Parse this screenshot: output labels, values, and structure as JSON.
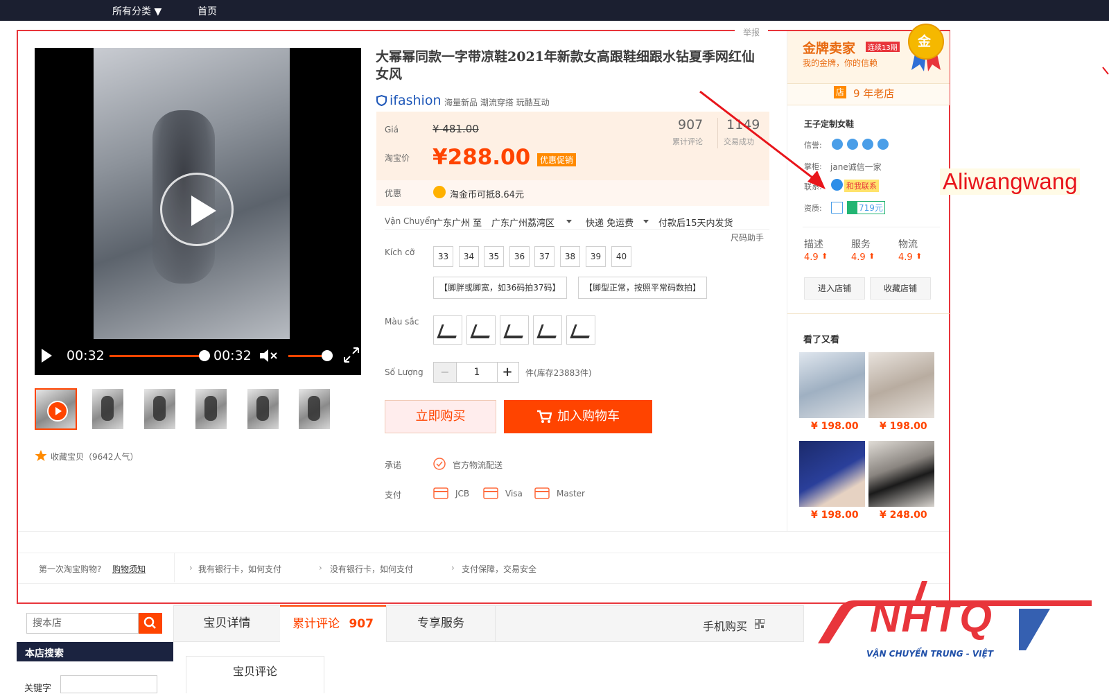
{
  "topnav": {
    "all_categories": "所有分类 ▼",
    "home": "首页"
  },
  "report_link": "举报",
  "video": {
    "current_time": "00:32",
    "duration": "00:32"
  },
  "favorite": {
    "text": "收藏宝贝（9642人气）"
  },
  "product": {
    "title": "大幂幂同款一字带凉鞋2021年新款女高跟鞋细跟水钻夏季网红仙女风",
    "ifashion_brand": "ifashion",
    "ifashion_tagline": "海量新品 潮流穿搭 玩酷互动",
    "original_price_label": "Giá",
    "original_price": "¥ 481.00",
    "taobao_price_label": "淘宝价",
    "price": "¥288.00",
    "promo_badge": "优惠促销",
    "reviews_count": "907",
    "reviews_label": "累计评论",
    "sales_count": "1149",
    "sales_label": "交易成功",
    "discount_label": "优惠",
    "discount_text": "淘金币可抵8.64元",
    "shipping_label": "Vận Chuyển",
    "shipping_from": "广东广州 至",
    "shipping_to": "广东广州荔湾区",
    "shipping_method": "快递 免运费",
    "shipping_time": "付款后15天内发货",
    "size_helper": "尺码助手",
    "size_label": "Kích cỡ",
    "sizes": [
      "33",
      "34",
      "35",
      "36",
      "37",
      "38",
      "39",
      "40"
    ],
    "size_tips": [
      "【脚胖或脚宽，如36码拍37码】",
      "【脚型正常，按照平常码数拍】"
    ],
    "color_label": "Màu sắc",
    "quantity_label": "Số Lượng",
    "quantity_value": "1",
    "quantity_minus": "−",
    "quantity_plus": "+",
    "stock_text": "件(库存23883件)",
    "buy_now": "立即购买",
    "add_to_cart": "加入购物车",
    "promise_label": "承诺",
    "promise_text": "官方物流配送",
    "payment_label": "支付",
    "payments": [
      "JCB",
      "Visa",
      "Master"
    ]
  },
  "seller": {
    "gold_title": "金牌卖家",
    "gold_badge": "连续13期",
    "gold_subtitle": "我的金牌，你的信赖",
    "gold_medal": "金",
    "store_age_icon": "店",
    "store_age": "9 年老店",
    "shop_name": "王子定制女鞋",
    "credit_label": "信誉:",
    "keeper_label": "掌柜:",
    "keeper_name": "jane诚信一家",
    "contact_label": "联系:",
    "contact_button": "和我联系",
    "qualification_label": "资质:",
    "deposit": "719元",
    "stats": [
      {
        "label": "描述",
        "value": "4.9"
      },
      {
        "label": "服务",
        "value": "4.9"
      },
      {
        "label": "物流",
        "value": "4.9"
      }
    ],
    "enter_shop": "进入店铺",
    "fav_shop": "收藏店铺",
    "also_viewed": "看了又看",
    "recommendations": [
      {
        "price": "¥ 198.00"
      },
      {
        "price": "¥ 198.00"
      },
      {
        "price": "¥ 198.00"
      },
      {
        "price": "¥ 248.00"
      }
    ]
  },
  "annotation": {
    "label": "Aliwangwang"
  },
  "help_bar": {
    "first_time": "第一次淘宝购物?",
    "buy_guide": "购物须知",
    "links": [
      "我有银行卡，如何支付",
      "没有银行卡，如何支付",
      "支付保障，交易安全"
    ]
  },
  "bottom": {
    "search_placeholder": "搜本店",
    "shop_search_title": "本店搜索",
    "keyword_label": "关键字",
    "tabs": [
      {
        "label": "宝贝详情"
      },
      {
        "label": "累计评论",
        "count": "907"
      },
      {
        "label": "专享服务"
      }
    ],
    "mobile_buy": "手机购买",
    "review_tab": "宝贝评论"
  },
  "watermark": {
    "brand": "NHTQ",
    "tagline": "VẬN CHUYỂN TRUNG - VIỆT"
  },
  "colors": {
    "accent": "#ff4400",
    "frame_red": "#e8353b",
    "nav_bg": "#1b1f30",
    "link_blue": "#1e57b8"
  }
}
